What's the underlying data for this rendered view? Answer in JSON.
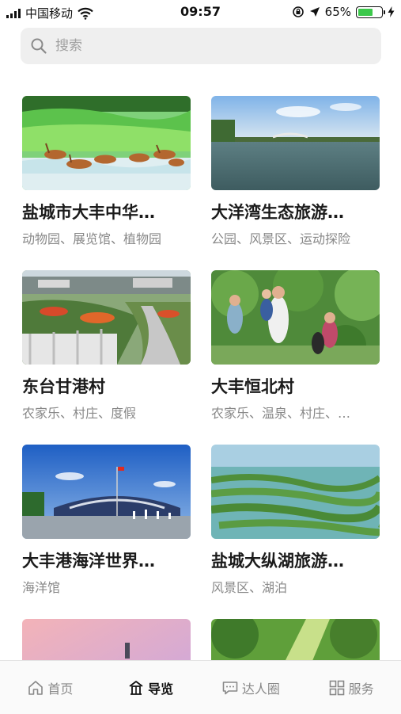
{
  "status": {
    "carrier": "中国移动",
    "time": "09:57",
    "battery": "65%",
    "battery_level": 0.65
  },
  "search": {
    "placeholder": "搜索"
  },
  "cards": [
    {
      "title": "盐城市大丰中华…",
      "tags": "动物园、展览馆、植物园"
    },
    {
      "title": "大洋湾生态旅游…",
      "tags": "公园、风景区、运动探险"
    },
    {
      "title": "东台甘港村",
      "tags": "农家乐、村庄、度假"
    },
    {
      "title": "大丰恒北村",
      "tags": "农家乐、温泉、村庄、…"
    },
    {
      "title": "大丰港海洋世界…",
      "tags": "海洋馆"
    },
    {
      "title": "盐城大纵湖旅游…",
      "tags": "风景区、湖泊"
    }
  ],
  "tabs": [
    {
      "label": "首页",
      "icon": "home-icon"
    },
    {
      "label": "导览",
      "icon": "guide-icon"
    },
    {
      "label": "达人圈",
      "icon": "chat-icon"
    },
    {
      "label": "服务",
      "icon": "grid-icon"
    }
  ],
  "colors": {
    "battery": "#3cc84b",
    "search_bg": "#efefef",
    "active_tab": "#111111"
  }
}
